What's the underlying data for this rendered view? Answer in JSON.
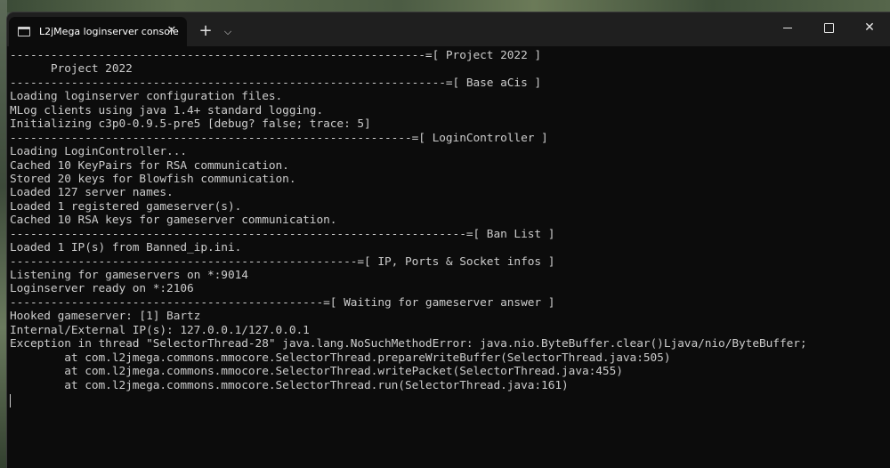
{
  "window": {
    "tab_title": "L2jMega loginserver console",
    "close_tab_glyph": "✕",
    "new_tab_glyph": "+",
    "dropdown_glyph": "⌵",
    "close_window_glyph": "✕"
  },
  "icons": {
    "tab_icon": "terminal-icon",
    "tab_close": "close-icon",
    "new_tab": "plus-icon",
    "dropdown": "chevron-down-icon",
    "minimize": "minimize-icon",
    "maximize": "maximize-icon",
    "close": "close-icon"
  },
  "colors": {
    "console_bg": "#0c0c0c",
    "console_text": "#cccccc",
    "titlebar_bg": "#1f1f1f"
  },
  "console": {
    "lines": [
      "-------------------------------------------------------------=[ Project 2022 ]",
      "      Project 2022",
      "----------------------------------------------------------------=[ Base aCis ]",
      "Loading loginserver configuration files.",
      "MLog clients using java 1.4+ standard logging.",
      "Initializing c3p0-0.9.5-pre5 [debug? false; trace: 5]",
      "-----------------------------------------------------------=[ LoginController ]",
      "Loading LoginController...",
      "Cached 10 KeyPairs for RSA communication.",
      "Stored 20 keys for Blowfish communication.",
      "Loaded 127 server names.",
      "Loaded 1 registered gameserver(s).",
      "Cached 10 RSA keys for gameserver communication.",
      "-------------------------------------------------------------------=[ Ban List ]",
      "Loaded 1 IP(s) from Banned_ip.ini.",
      "---------------------------------------------------=[ IP, Ports & Socket infos ]",
      "Listening for gameservers on *:9014",
      "Loginserver ready on *:2106",
      "----------------------------------------------=[ Waiting for gameserver answer ]",
      "Hooked gameserver: [1] Bartz",
      "Internal/External IP(s): 127.0.0.1/127.0.0.1",
      "Exception in thread \"SelectorThread-28\" java.lang.NoSuchMethodError: java.nio.ByteBuffer.clear()Ljava/nio/ByteBuffer;",
      "        at com.l2jmega.commons.mmocore.SelectorThread.prepareWriteBuffer(SelectorThread.java:505)",
      "        at com.l2jmega.commons.mmocore.SelectorThread.writePacket(SelectorThread.java:455)",
      "        at com.l2jmega.commons.mmocore.SelectorThread.run(SelectorThread.java:161)"
    ]
  }
}
